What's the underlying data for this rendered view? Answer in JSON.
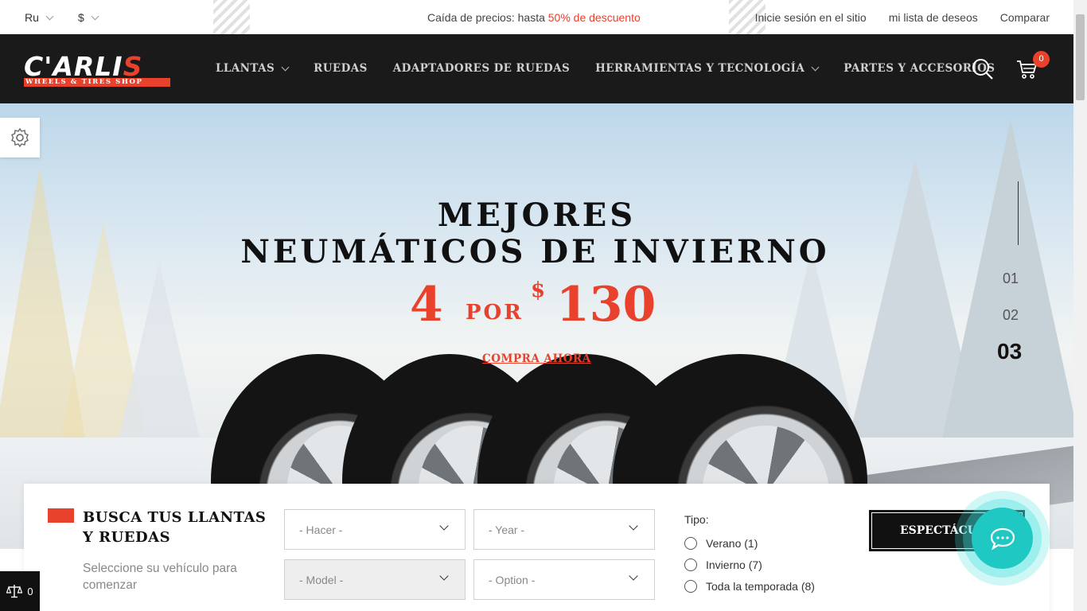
{
  "topbar": {
    "language": "Ru",
    "currency": "$",
    "promo_text": "Caída de precios: hasta ",
    "promo_highlight": "50% de descuento",
    "links": [
      "Inicie sesión en el sitio",
      "mi lista de deseos",
      "Comparar"
    ]
  },
  "logo": {
    "word": "C'ARLI",
    "letter": "S",
    "tagline": "WHEELS & TIRES SHOP"
  },
  "nav": {
    "items": [
      {
        "label": "LLANTAS",
        "dropdown": true
      },
      {
        "label": "RUEDAS",
        "dropdown": false
      },
      {
        "label": "ADAPTADORES DE RUEDAS",
        "dropdown": false
      },
      {
        "label": "HERRAMIENTAS Y TECNOLOGÍA",
        "dropdown": true
      },
      {
        "label": "PARTES Y ACCESORIOS",
        "dropdown": false
      }
    ],
    "cart_count": "0",
    "icons": [
      "search-icon",
      "cart-icon"
    ]
  },
  "hero": {
    "title_line1": "MEJORES",
    "title_line2": "NEUMÁTICOS DE INVIERNO",
    "price_qty": "4",
    "price_por": "POR",
    "price_currency": "$",
    "price_amount": "130",
    "cta": "COMPRA AHORA",
    "slides": [
      "01",
      "02",
      "03"
    ],
    "active_slide": "03"
  },
  "search": {
    "title": "BUSCA TUS LLANTAS Y RUEDAS",
    "subtitle": "Seleccione su vehículo para comenzar",
    "selects": {
      "make": "- Hacer -",
      "year": "- Year -",
      "model": "- Model -",
      "option": "- Option -"
    },
    "type_label": "Tipo:",
    "types": [
      "Verano (1)",
      "Invierno (7)",
      "Toda la temporada (8)"
    ],
    "button": "ESPECTÁCULO"
  },
  "compare_widget": {
    "count": "0"
  },
  "colors": {
    "accent": "#e8412c",
    "nav_bg": "#1a1a1a",
    "chat": "#1fc8c2"
  }
}
